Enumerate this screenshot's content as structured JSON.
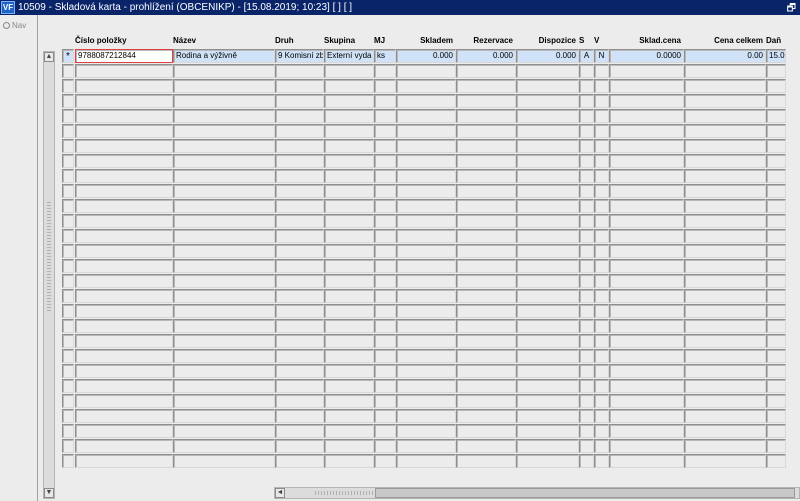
{
  "window": {
    "title": "10509 - Skladová karta - prohlížení (OBCENIKP) - [15.08.2019; 10:23]  [ ]  [ ]",
    "app_icon": "VF",
    "restore_icon": "restore-icon"
  },
  "nav": {
    "label": "Nav"
  },
  "grid": {
    "columns": [
      {
        "key": "cislo",
        "label": "Číslo položky",
        "align": "left"
      },
      {
        "key": "nazev",
        "label": "Název",
        "align": "left"
      },
      {
        "key": "druh",
        "label": "Druh",
        "align": "left"
      },
      {
        "key": "skupina",
        "label": "Skupina",
        "align": "left"
      },
      {
        "key": "mj",
        "label": "MJ",
        "align": "left"
      },
      {
        "key": "skladem",
        "label": "Skladem",
        "align": "right"
      },
      {
        "key": "rezervace",
        "label": "Rezervace",
        "align": "right"
      },
      {
        "key": "dispozice",
        "label": "Dispozice",
        "align": "right"
      },
      {
        "key": "s",
        "label": "S",
        "align": "left"
      },
      {
        "key": "v",
        "label": "V",
        "align": "left"
      },
      {
        "key": "sklad_cena",
        "label": "Sklad.cena",
        "align": "right"
      },
      {
        "key": "cena_celkem",
        "label": "Cena celkem",
        "align": "right"
      },
      {
        "key": "dan",
        "label": "Daň",
        "align": "left"
      }
    ],
    "current_row_marker": "*",
    "rows": [
      {
        "cislo": "9788087212844",
        "nazev": "Rodina a výživně",
        "druh": "9 Komisní zb",
        "skupina": "Externí vyda",
        "mj": "ks",
        "skladem": "0.000",
        "rezervace": "0.000",
        "dispozice": "0.000",
        "s": "A",
        "v": "N",
        "sklad_cena": "0.0000",
        "cena_celkem": "0.00",
        "dan": "15.0"
      }
    ],
    "empty_row_count": 27
  }
}
